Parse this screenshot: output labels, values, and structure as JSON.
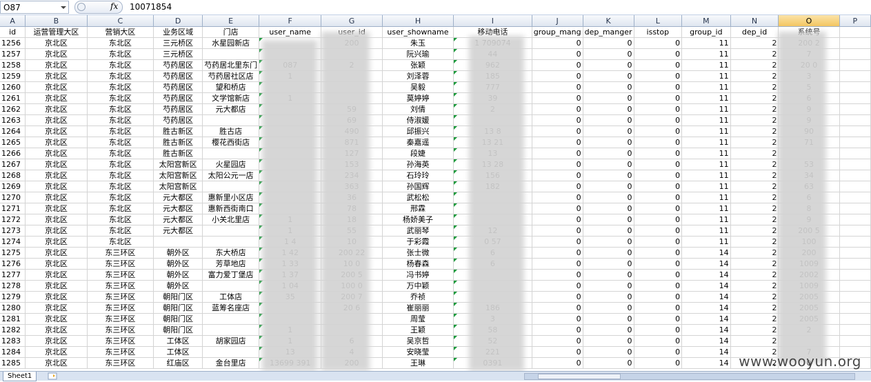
{
  "formula_bar": {
    "name_box": "O87",
    "fx_label": "fx",
    "value": "10071854"
  },
  "columns": [
    "A",
    "B",
    "C",
    "D",
    "E",
    "F",
    "G",
    "H",
    "I",
    "J",
    "K",
    "L",
    "M",
    "N",
    "O",
    "P"
  ],
  "selected_column": "O",
  "field_headers": [
    "id",
    "运营管理大区",
    "营销大区",
    "业务区域",
    "门店",
    "user_name",
    "user_id",
    "user_showname",
    "移动电话",
    "group_mang",
    "dep_manger",
    "isstop",
    "group_id",
    "dep_id",
    "系统号",
    ""
  ],
  "rows": [
    {
      "id": "1256",
      "b": "京北区",
      "c": "东北区",
      "d": "三元桥区",
      "e": "水星园新店",
      "f": "",
      "g": "200",
      "h": "朱玉",
      "i": "1    709074",
      "j": "0",
      "k": "0",
      "l": "0",
      "m": "11",
      "n": "2",
      "o": "200  2"
    },
    {
      "id": "1257",
      "b": "京北区",
      "c": "东北区",
      "d": "三元桥区",
      "e": "",
      "f": "",
      "g": "",
      "h": "阮兴瑜",
      "i": "       44",
      "j": "0",
      "k": "0",
      "l": "0",
      "m": "11",
      "n": "2",
      "o": "    7"
    },
    {
      "id": "1258",
      "b": "京北区",
      "c": "东北区",
      "d": "芍药居区",
      "e": "芍药居北里东门",
      "f": "   087",
      "g": "2",
      "h": "张颖",
      "i": "      962",
      "j": "0",
      "k": "0",
      "l": "0",
      "m": "11",
      "n": "2",
      "o": "20   0"
    },
    {
      "id": "1259",
      "b": "京北区",
      "c": "东北区",
      "d": "芍药居区",
      "e": "芍药居社区店",
      "f": "1",
      "g": "",
      "h": "刘泽蓉",
      "i": "      185",
      "j": "0",
      "k": "0",
      "l": "0",
      "m": "11",
      "n": "2",
      "o": "    3"
    },
    {
      "id": "1260",
      "b": "京北区",
      "c": "东北区",
      "d": "芍药居区",
      "e": "望和桥店",
      "f": "",
      "g": "",
      "h": "吴毅",
      "i": "      777",
      "j": "0",
      "k": "0",
      "l": "0",
      "m": "11",
      "n": "2",
      "o": "    5"
    },
    {
      "id": "1261",
      "b": "京北区",
      "c": "东北区",
      "d": "芍药居区",
      "e": "文学馆新店",
      "f": "1",
      "g": "",
      "h": "莫婷婷",
      "i": "      39",
      "j": "0",
      "k": "0",
      "l": "0",
      "m": "11",
      "n": "2",
      "o": "    6"
    },
    {
      "id": "1262",
      "b": "京北区",
      "c": "东北区",
      "d": "芍药居区",
      "e": "元大都店",
      "f": "",
      "g": "  59",
      "h": "刘倩",
      "i": "      2",
      "j": "0",
      "k": "0",
      "l": "0",
      "m": "11",
      "n": "2",
      "o": "    9"
    },
    {
      "id": "1263",
      "b": "京北区",
      "c": "东北区",
      "d": "芍药居区",
      "e": "",
      "f": "",
      "g": "  69",
      "h": "侍淑媛",
      "i": "",
      "j": "0",
      "k": "0",
      "l": "0",
      "m": "11",
      "n": "2",
      "o": "    9"
    },
    {
      "id": "1264",
      "b": "京北区",
      "c": "东北区",
      "d": "胜古新区",
      "e": "胜古店",
      "f": "",
      "g": "490",
      "h": "邱振兴",
      "i": "13   8",
      "j": "0",
      "k": "0",
      "l": "0",
      "m": "11",
      "n": "2",
      "o": "    90"
    },
    {
      "id": "1265",
      "b": "京北区",
      "c": "东北区",
      "d": "胜古新区",
      "e": "樱花西街店",
      "f": "",
      "g": "871",
      "h": "秦嘉遥",
      "i": "13   21",
      "j": "0",
      "k": "0",
      "l": "0",
      "m": "11",
      "n": "2",
      "o": "    71"
    },
    {
      "id": "1266",
      "b": "京北区",
      "c": "东北区",
      "d": "胜古新区",
      "e": "",
      "f": "",
      "g": "127",
      "h": "段婕",
      "i": "13",
      "j": "0",
      "k": "0",
      "l": "0",
      "m": "11",
      "n": "2",
      "o": ""
    },
    {
      "id": "1267",
      "b": "京北区",
      "c": "东北区",
      "d": "太阳宫新区",
      "e": "火星园店",
      "f": "",
      "g": "153",
      "h": "孙海英",
      "i": "13   28",
      "j": "0",
      "k": "0",
      "l": "0",
      "m": "11",
      "n": "2",
      "o": "    53"
    },
    {
      "id": "1268",
      "b": "京北区",
      "c": "东北区",
      "d": "太阳宫新区",
      "e": "太阳公元一店",
      "f": "",
      "g": "234",
      "h": "石玲玲",
      "i": "156",
      "j": "0",
      "k": "0",
      "l": "0",
      "m": "11",
      "n": "2",
      "o": "    34"
    },
    {
      "id": "1269",
      "b": "京北区",
      "c": "东北区",
      "d": "太阳宫新区",
      "e": "",
      "f": "",
      "g": "363",
      "h": "孙国辉",
      "i": "182",
      "j": "0",
      "k": "0",
      "l": "0",
      "m": "11",
      "n": "2",
      "o": "    63"
    },
    {
      "id": "1270",
      "b": "京北区",
      "c": "东北区",
      "d": "元大都区",
      "e": "惠新里小区店",
      "f": "",
      "g": "36",
      "h": "武松松",
      "i": "",
      "j": "0",
      "k": "0",
      "l": "0",
      "m": "11",
      "n": "2",
      "o": "    6"
    },
    {
      "id": "1271",
      "b": "京北区",
      "c": "东北区",
      "d": "元大都区",
      "e": "惠新西街南口",
      "f": "",
      "g": "78",
      "h": "邢霖",
      "i": "",
      "j": "0",
      "k": "0",
      "l": "0",
      "m": "11",
      "n": "2",
      "o": "    8"
    },
    {
      "id": "1272",
      "b": "京北区",
      "c": "东北区",
      "d": "元大都区",
      "e": "小关北里店",
      "f": "1",
      "g": "18",
      "h": "杨娇美子",
      "i": "",
      "j": "0",
      "k": "0",
      "l": "0",
      "m": "11",
      "n": "2",
      "o": "    9"
    },
    {
      "id": "1273",
      "b": "京北区",
      "c": "东北区",
      "d": "元大都区",
      "e": "",
      "f": "1",
      "g": "55",
      "h": "武丽琴",
      "i": "     12",
      "j": "0",
      "k": "0",
      "l": "0",
      "m": "11",
      "n": "2",
      "o": "200  5"
    },
    {
      "id": "1274",
      "b": "京北区",
      "c": "东北区",
      "d": "",
      "e": "",
      "f": "1   4",
      "g": "10",
      "h": "于彩霞",
      "i": "   0  57",
      "j": "0",
      "k": "0",
      "l": "0",
      "m": "11",
      "n": "2",
      "o": "100"
    },
    {
      "id": "1275",
      "b": "京北区",
      "c": "东三环区",
      "d": "朝外区",
      "e": "东大桥店",
      "f": "1   42",
      "g": "200  22",
      "h": "张士微",
      "i": "      6",
      "j": "0",
      "k": "0",
      "l": "0",
      "m": "14",
      "n": "2",
      "o": "200"
    },
    {
      "id": "1276",
      "b": "京北区",
      "c": "东三环区",
      "d": "朝外区",
      "e": "芳草地店",
      "f": "1   33",
      "g": "10   0",
      "h": "杨春森",
      "i": "      6",
      "j": "0",
      "k": "0",
      "l": "0",
      "m": "14",
      "n": "2",
      "o": "1009"
    },
    {
      "id": "1277",
      "b": "京北区",
      "c": "东三环区",
      "d": "朝外区",
      "e": "富力爱丁堡店",
      "f": "1   37",
      "g": "200  5",
      "h": "冯书婷",
      "i": "",
      "j": "0",
      "k": "0",
      "l": "0",
      "m": "14",
      "n": "2",
      "o": "2002"
    },
    {
      "id": "1278",
      "b": "京北区",
      "c": "东三环区",
      "d": "朝外区",
      "e": "",
      "f": "1   04",
      "g": "100   0",
      "h": "万中颖",
      "i": "",
      "j": "0",
      "k": "0",
      "l": "0",
      "m": "14",
      "n": "2",
      "o": "1009"
    },
    {
      "id": "1279",
      "b": "京北区",
      "c": "东三环区",
      "d": "朝阳门区",
      "e": "工体店",
      "f": "  35",
      "g": "200   7",
      "h": "乔祯",
      "i": "",
      "j": "0",
      "k": "0",
      "l": "0",
      "m": "14",
      "n": "2",
      "o": "2005"
    },
    {
      "id": "1280",
      "b": "京北区",
      "c": "东三环区",
      "d": "朝阳门区",
      "e": "蓝筹名座店",
      "f": "",
      "g": "20   6",
      "h": "崔丽丽",
      "i": "186",
      "j": "0",
      "k": "0",
      "l": "0",
      "m": "14",
      "n": "2",
      "o": "2005"
    },
    {
      "id": "1281",
      "b": "京北区",
      "c": "东三环区",
      "d": "朝阳门区",
      "e": "",
      "f": "",
      "g": "",
      "h": "周莹",
      "i": "      3",
      "j": "0",
      "k": "0",
      "l": "0",
      "m": "14",
      "n": "2",
      "o": "2005"
    },
    {
      "id": "1282",
      "b": "京北区",
      "c": "东三环区",
      "d": "朝阳门区",
      "e": "",
      "f": "1",
      "g": "",
      "h": "王颖",
      "i": "      58",
      "j": "0",
      "k": "0",
      "l": "0",
      "m": "14",
      "n": "2",
      "o": "2"
    },
    {
      "id": "1283",
      "b": "京北区",
      "c": "东三环区",
      "d": "工体区",
      "e": "胡家园店",
      "f": "1",
      "g": "  6",
      "h": "吴京哲",
      "i": "      52",
      "j": "0",
      "k": "0",
      "l": "0",
      "m": "14",
      "n": "2",
      "o": ""
    },
    {
      "id": "1284",
      "b": "京北区",
      "c": "东三环区",
      "d": "工体区",
      "e": "",
      "f": "13",
      "g": "  4",
      "h": "安晓莹",
      "i": "     221",
      "j": "0",
      "k": "0",
      "l": "0",
      "m": "14",
      "n": "2",
      "o": "   7"
    },
    {
      "id": "1285",
      "b": "京北区",
      "c": "东三环区",
      "d": "红庙区",
      "e": "金台里店",
      "f": "13699   391",
      "g": "200",
      "h": "王琳",
      "i": "     0391",
      "j": "0",
      "k": "0",
      "l": "0",
      "m": "14",
      "n": "2",
      "o": "   0"
    }
  ],
  "sheet_tab": "Sheet1",
  "watermark": "www.wooyun.org"
}
